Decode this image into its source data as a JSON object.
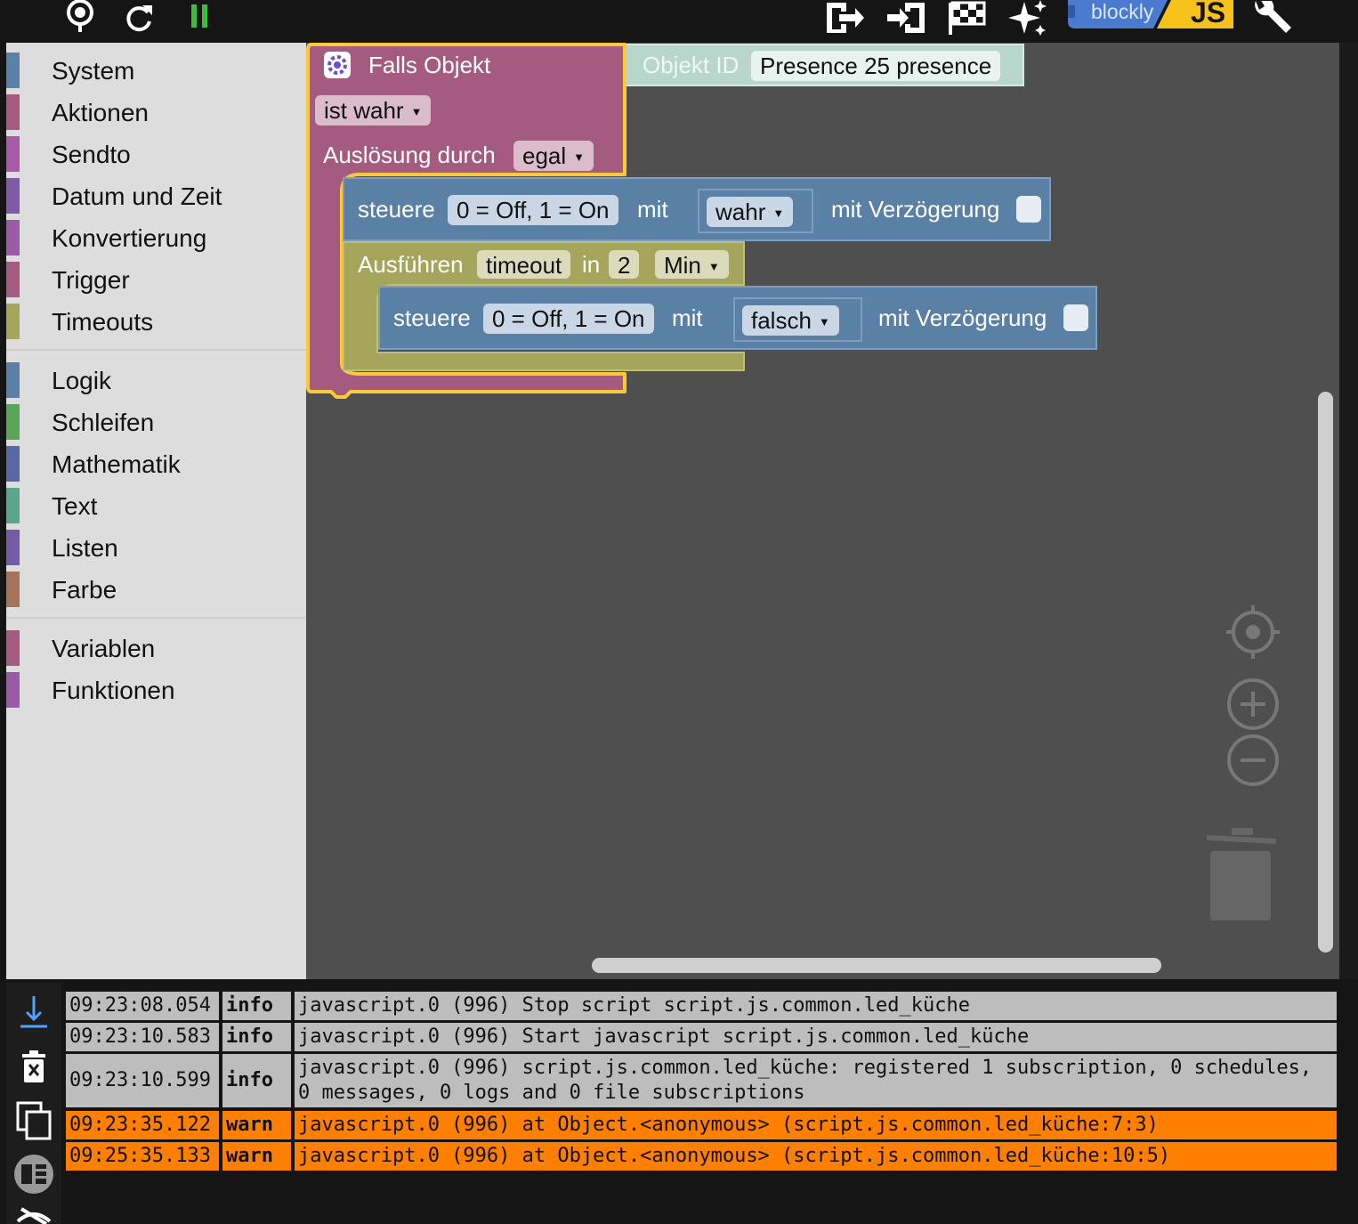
{
  "toolbar": {
    "left_icons": [
      "locate-icon",
      "refresh-icon",
      "pause-icon"
    ],
    "right_icons": [
      "export-icon",
      "import-icon",
      "flag-icon",
      "sparkle-icon",
      "wrench-icon"
    ],
    "logo": {
      "blockly": "blockly",
      "js": "JS"
    },
    "colors": {
      "pause": "#3dbd3d",
      "js_bg": "#f7c21c"
    }
  },
  "sidebar": {
    "groups": [
      [
        {
          "label": "System",
          "color": "#5b80a5"
        },
        {
          "label": "Aktionen",
          "color": "#a55b80"
        },
        {
          "label": "Sendto",
          "color": "#a55ba5"
        },
        {
          "label": "Datum und Zeit",
          "color": "#805ba5"
        },
        {
          "label": "Konvertierung",
          "color": "#9a5ca5"
        },
        {
          "label": "Trigger",
          "color": "#a55b80"
        },
        {
          "label": "Timeouts",
          "color": "#a5a55b"
        }
      ],
      [
        {
          "label": "Logik",
          "color": "#5b80a5"
        },
        {
          "label": "Schleifen",
          "color": "#5ba55b"
        },
        {
          "label": "Mathematik",
          "color": "#5b67a5"
        },
        {
          "label": "Text",
          "color": "#5ba58c"
        },
        {
          "label": "Listen",
          "color": "#745ba5"
        },
        {
          "label": "Farbe",
          "color": "#a5745b"
        }
      ],
      [
        {
          "label": "Variablen",
          "color": "#a55b80"
        },
        {
          "label": "Funktionen",
          "color": "#995ba5"
        }
      ]
    ]
  },
  "blocks": {
    "trigger": {
      "title": "Falls Objekt",
      "condition": "ist wahr",
      "trigger_label": "Auslösung durch",
      "trigger_value": "egal",
      "color": "#a55b80",
      "highlight": "#fcc93a"
    },
    "object_id": {
      "label": "Objekt ID",
      "value": "Presence 25 presence",
      "color": "#b8d6cc"
    },
    "control1": {
      "label": "steuere",
      "target": "0 = Off, 1 = On",
      "with": "mit",
      "value": "wahr",
      "delay": "mit Verzögerung",
      "color": "#5b80a5"
    },
    "timeout": {
      "label": "Ausführen",
      "name": "timeout",
      "in": "in",
      "amount": "2",
      "unit": "Min",
      "color": "#a5a55b"
    },
    "control2": {
      "label": "steuere",
      "target": "0 = Off, 1 = On",
      "with": "mit",
      "value": "falsch",
      "delay": "mit Verzögerung",
      "color": "#5b80a5"
    }
  },
  "workspace": {
    "controls": [
      "center-icon",
      "zoom-in-icon",
      "zoom-out-icon",
      "trash-icon"
    ],
    "background": "#4f4f4f"
  },
  "log": {
    "buttons": [
      "scroll-down-icon",
      "clear-log-icon",
      "copy-icon",
      "layout-icon",
      "hide-icon"
    ],
    "rows": [
      {
        "time": "09:23:08.054",
        "level": "info",
        "message": "javascript.0 (996) Stop script script.js.common.led_küche"
      },
      {
        "time": "09:23:10.583",
        "level": "info",
        "message": "javascript.0 (996) Start javascript script.js.common.led_küche"
      },
      {
        "time": "09:23:10.599",
        "level": "info",
        "message": "javascript.0 (996) script.js.common.led_küche: registered 1 subscription, 0 schedules, 0 messages, 0 logs and 0 file subscriptions"
      },
      {
        "time": "09:23:35.122",
        "level": "warn",
        "message": "javascript.0 (996) at Object.<anonymous> (script.js.common.led_küche:7:3)"
      },
      {
        "time": "09:25:35.133",
        "level": "warn",
        "message": "javascript.0 (996) at Object.<anonymous> (script.js.common.led_küche:10:5)"
      }
    ],
    "colors": {
      "info": "#bdbdbd",
      "warn": "#ff8000"
    }
  }
}
